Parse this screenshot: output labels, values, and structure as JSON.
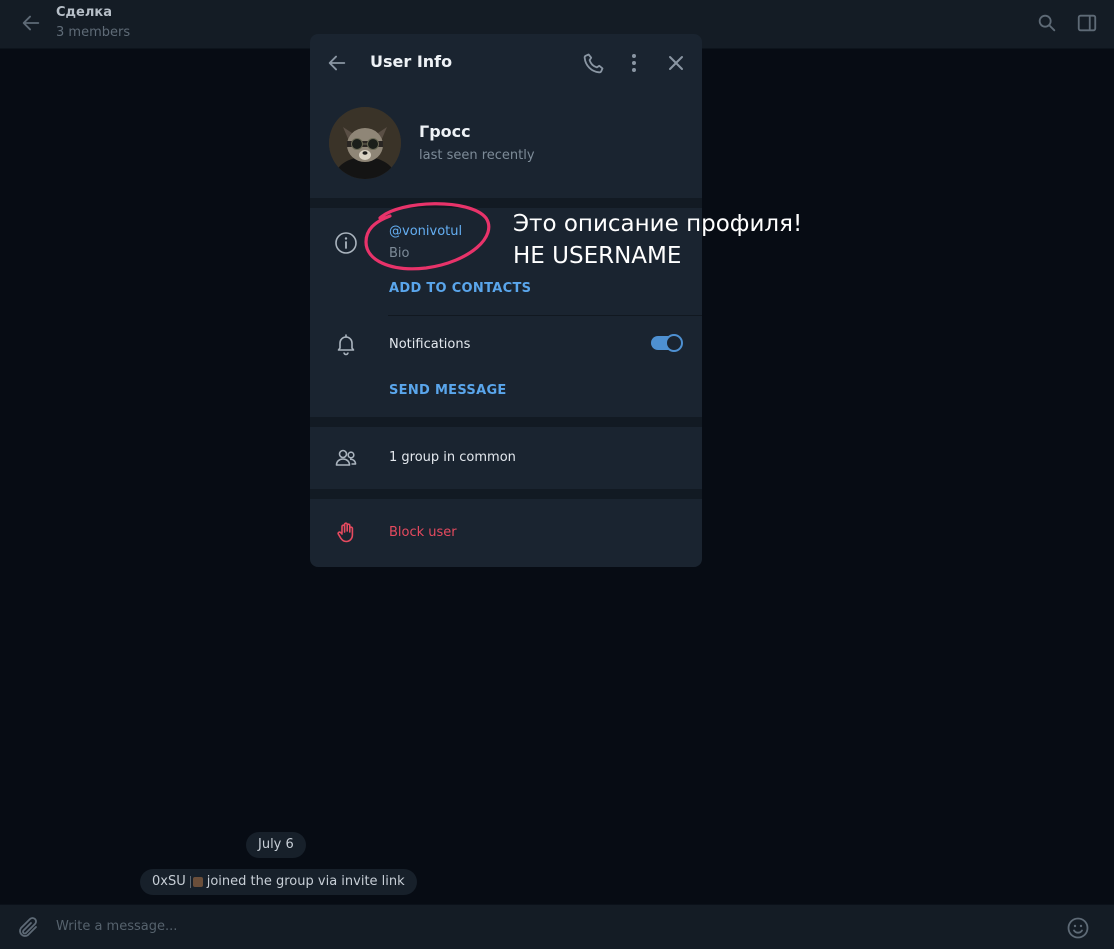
{
  "chat": {
    "title": "Сделка",
    "subtitle": "3 members",
    "date_divider": "July 6",
    "service_message": {
      "user": "0xSU",
      "text": "joined the group via invite link"
    },
    "composer_placeholder": "Write a message..."
  },
  "user_info": {
    "title": "User Info",
    "name": "Гросс",
    "status": "last seen recently",
    "username": "@vonivotul",
    "bio_label": "Bio",
    "add_contacts": "ADD TO CONTACTS",
    "notifications_label": "Notifications",
    "notifications_enabled": true,
    "send_message": "SEND MESSAGE",
    "groups_in_common": "1 group in common",
    "block_user": "Block user"
  },
  "annotation": {
    "line1": "Это описание профиля!",
    "line2": "НЕ USERNAME",
    "color": "#e8336a"
  },
  "colors": {
    "accent": "#5aa6ec",
    "danger": "#e64a5f",
    "modal_bg": "#1a2430"
  }
}
